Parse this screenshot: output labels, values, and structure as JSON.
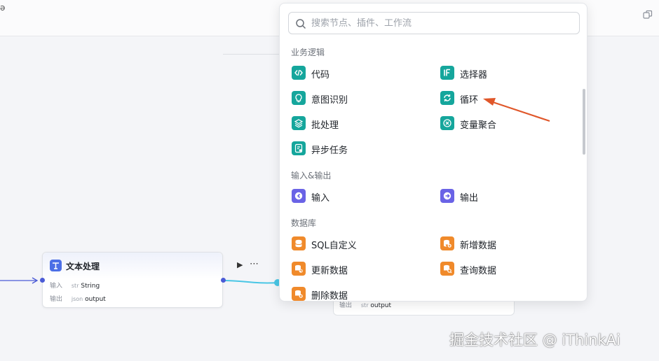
{
  "toolbar": {
    "corner_glyph": "ǝ"
  },
  "search": {
    "placeholder": "搜索节点、插件、工作流",
    "value": ""
  },
  "sections": {
    "logic": {
      "title": "业务逻辑",
      "items": [
        {
          "label": "代码",
          "icon": "code-icon",
          "color": "#15a69c"
        },
        {
          "label": "选择器",
          "icon": "if-icon",
          "color": "#15a69c"
        },
        {
          "label": "意图识别",
          "icon": "intent-icon",
          "color": "#15a69c"
        },
        {
          "label": "循环",
          "icon": "loop-icon",
          "color": "#15a69c"
        },
        {
          "label": "批处理",
          "icon": "layers-icon",
          "color": "#15a69c"
        },
        {
          "label": "变量聚合",
          "icon": "aggregate-icon",
          "color": "#15a69c"
        },
        {
          "label": "异步任务",
          "icon": "async-task-icon",
          "color": "#15a69c"
        }
      ]
    },
    "io": {
      "title": "输入&输出",
      "items": [
        {
          "label": "输入",
          "icon": "input-icon",
          "color": "#6a63e6"
        },
        {
          "label": "输出",
          "icon": "output-icon",
          "color": "#6a63e6"
        }
      ]
    },
    "database": {
      "title": "数据库",
      "items": [
        {
          "label": "SQL自定义",
          "icon": "database-icon",
          "color": "#f08a2b"
        },
        {
          "label": "新增数据",
          "icon": "database-add-icon",
          "color": "#f08a2b"
        },
        {
          "label": "更新数据",
          "icon": "database-update-icon",
          "color": "#f08a2b"
        },
        {
          "label": "查询数据",
          "icon": "database-search-icon",
          "color": "#f08a2b"
        },
        {
          "label": "删除数据",
          "icon": "database-delete-icon",
          "color": "#f08a2b"
        }
      ]
    }
  },
  "node": {
    "title": "文本处理",
    "input_label": "输入",
    "input_type": "str",
    "input_value": "String",
    "output_label": "输出",
    "output_type": "json",
    "output_value": "output"
  },
  "node2": {
    "output_label": "输出",
    "output_type": "str",
    "output_value": "output"
  },
  "watermark": "掘金技术社区 @ iThinkAi",
  "colors": {
    "accent_arrow": "#e0572a",
    "edge": "#49c6e5",
    "edge_in": "#4b5bd6"
  }
}
